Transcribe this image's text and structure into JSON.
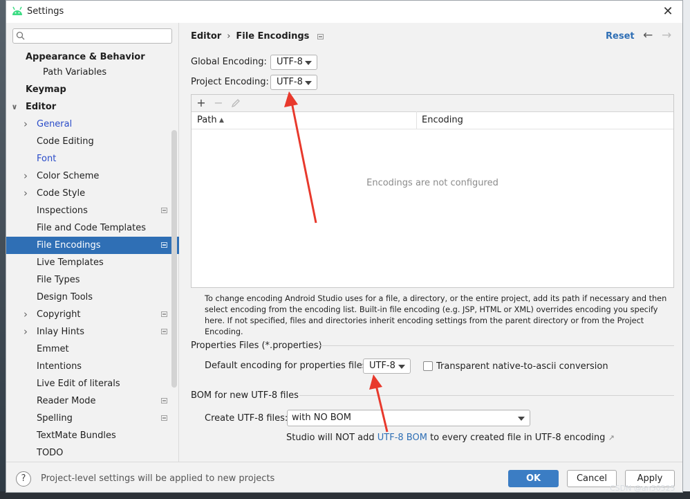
{
  "window": {
    "title": "Settings"
  },
  "sidebar": {
    "search_value": "",
    "items": [
      {
        "label": "Appearance & Behavior",
        "bold": true
      },
      {
        "label": "Path Variables"
      },
      {
        "label": "Keymap",
        "bold": true
      },
      {
        "label": "Editor",
        "bold": true,
        "expanded": true
      },
      {
        "label": "General",
        "has_children": true,
        "highlight": true
      },
      {
        "label": "Code Editing"
      },
      {
        "label": "Font",
        "highlight": true
      },
      {
        "label": "Color Scheme",
        "has_children": true
      },
      {
        "label": "Code Style",
        "has_children": true
      },
      {
        "label": "Inspections",
        "project_level": true
      },
      {
        "label": "File and Code Templates"
      },
      {
        "label": "File Encodings",
        "selected": true,
        "project_level": true
      },
      {
        "label": "Live Templates"
      },
      {
        "label": "File Types"
      },
      {
        "label": "Design Tools"
      },
      {
        "label": "Copyright",
        "has_children": true,
        "project_level": true
      },
      {
        "label": "Inlay Hints",
        "has_children": true,
        "project_level": true
      },
      {
        "label": "Emmet"
      },
      {
        "label": "Intentions"
      },
      {
        "label": "Live Edit of literals"
      },
      {
        "label": "Reader Mode",
        "project_level": true
      },
      {
        "label": "Spelling",
        "project_level": true
      },
      {
        "label": "TextMate Bundles"
      },
      {
        "label": "TODO"
      }
    ]
  },
  "header": {
    "breadcrumb_parent": "Editor",
    "breadcrumb_separator": "›",
    "breadcrumb_current": "File Encodings",
    "reset_label": "Reset",
    "back_icon": "arrow-left-icon",
    "forward_icon": "arrow-right-icon"
  },
  "encodings": {
    "global_label": "Global Encoding:",
    "global_value": "UTF-8",
    "project_label": "Project Encoding:",
    "project_value": "UTF-8"
  },
  "table": {
    "toolbar": {
      "add": "+",
      "remove": "−"
    },
    "columns": [
      "Path",
      "Encoding"
    ],
    "sort_indicator": "▲",
    "rows": [],
    "empty_text": "Encodings are not configured"
  },
  "help_text": "To change encoding Android Studio uses for a file, a directory, or the entire project, add its path if necessary and then select encoding from the encoding list. Built-in file encoding (e.g. JSP, HTML or XML) overrides encoding you specify here. If not specified, files and directories inherit encoding settings from the parent directory or from the Project Encoding.",
  "properties": {
    "section_title": "Properties Files (*.properties)",
    "default_label": "Default encoding for properties files:",
    "default_value": "UTF-8",
    "native_label": "Transparent native-to-ascii conversion",
    "native_checked": false
  },
  "bom": {
    "section_title": "BOM for new UTF-8 files",
    "create_label": "Create UTF-8 files:",
    "create_value": "with NO BOM",
    "note_prefix": "Studio will NOT add ",
    "note_link": "UTF-8 BOM",
    "note_suffix": " to every created file in UTF-8 encoding",
    "note_arrow": "↗"
  },
  "footer": {
    "help": "?",
    "message": "Project-level settings will be applied to new projects",
    "ok": "OK",
    "cancel": "Cancel",
    "apply": "Apply"
  },
  "watermark": "CSDN @an50525",
  "colors": {
    "accent": "#2f6fb5",
    "selection": "#2f6fb5",
    "primary_button": "#3b7dc4",
    "annotation_arrow": "#e8392c"
  }
}
